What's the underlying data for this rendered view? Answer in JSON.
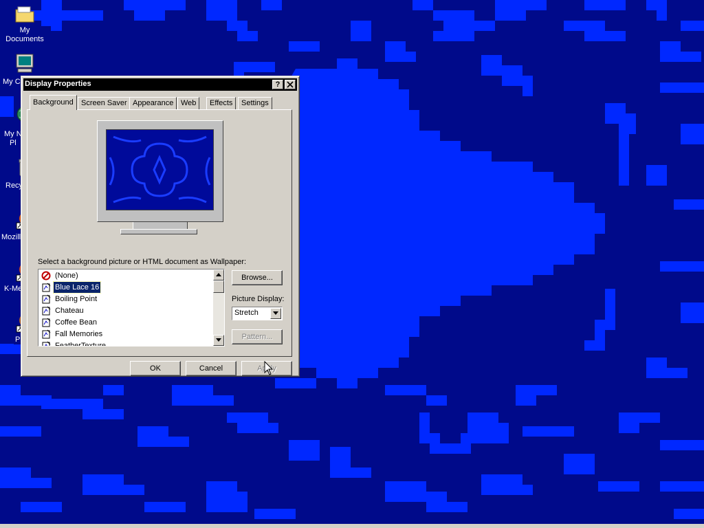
{
  "desktop": {
    "icons": [
      {
        "label": "My Documents",
        "icon": "folder-icon"
      },
      {
        "label": "My C",
        "icon": "computer-icon"
      },
      {
        "label": "My N\nPl",
        "icon": "network-icon"
      },
      {
        "label": "Recy",
        "icon": "recycle-bin-icon"
      },
      {
        "label": "Mozilla",
        "icon": "mozilla-icon"
      },
      {
        "label": "K-Me",
        "icon": "kmeleon-icon"
      },
      {
        "label": "Pl",
        "icon": "app-icon"
      }
    ],
    "colors": {
      "wallpaper_dark": "#000a8a",
      "wallpaper_light": "#0028ff"
    }
  },
  "window": {
    "title": "Display Properties",
    "help_label": "?",
    "close_label": "✕",
    "tabs": [
      {
        "label": "Background",
        "active": true
      },
      {
        "label": "Screen Saver",
        "active": false
      },
      {
        "label": "Appearance",
        "active": false
      },
      {
        "label": "Web",
        "active": false
      },
      {
        "label": "Effects",
        "active": false
      },
      {
        "label": "Settings",
        "active": false
      }
    ],
    "select_label": "Select a background picture or HTML document as Wallpaper:",
    "wallpapers": [
      {
        "label": "(None)",
        "icon": "none-icon",
        "selected": false
      },
      {
        "label": "Blue Lace 16",
        "icon": "bitmap-icon",
        "selected": true
      },
      {
        "label": "Boiling Point",
        "icon": "bitmap-icon",
        "selected": false
      },
      {
        "label": "Chateau",
        "icon": "bitmap-icon",
        "selected": false
      },
      {
        "label": "Coffee Bean",
        "icon": "bitmap-icon",
        "selected": false
      },
      {
        "label": "Fall Memories",
        "icon": "bitmap-icon",
        "selected": false
      },
      {
        "label": "FeatherTexture",
        "icon": "bitmap-icon",
        "selected": false
      }
    ],
    "browse_label": "Browse...",
    "picture_display_label": "Picture Display:",
    "picture_display_value": "Stretch",
    "pattern_label": "Pattern...",
    "ok_label": "OK",
    "cancel_label": "Cancel",
    "apply_label": "Apply"
  }
}
